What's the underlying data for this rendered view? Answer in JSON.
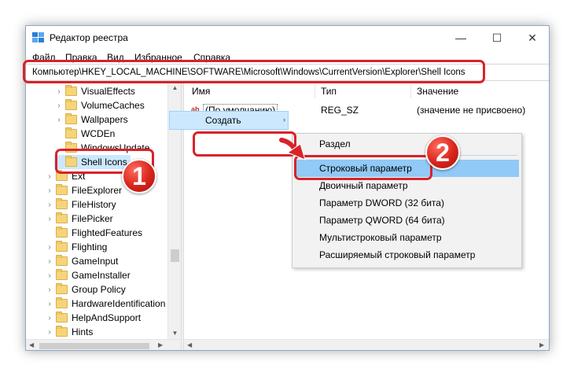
{
  "window": {
    "title": "Редактор реестра",
    "minimize_glyph": "—",
    "maximize_glyph": "☐",
    "close_glyph": "✕"
  },
  "menu": [
    "Файл",
    "Правка",
    "Вид",
    "Избранное",
    "Справка"
  ],
  "address": "Компьютер\\HKEY_LOCAL_MACHINE\\SOFTWARE\\Microsoft\\Windows\\CurrentVersion\\Explorer\\Shell Icons",
  "tree": {
    "items": [
      {
        "label": "VisualEffects",
        "expander": "›"
      },
      {
        "label": "VolumeCaches",
        "expander": "›"
      },
      {
        "label": "Wallpapers",
        "expander": "›"
      },
      {
        "label": "WCDEn",
        "expander": ""
      },
      {
        "label": "WindowsUpdate",
        "expander": ""
      },
      {
        "label": "Shell Icons",
        "expander": ""
      },
      {
        "label": "Ext",
        "expander": "›"
      },
      {
        "label": "FileExplorer",
        "expander": "›"
      },
      {
        "label": "FileHistory",
        "expander": "›"
      },
      {
        "label": "FilePicker",
        "expander": "›"
      },
      {
        "label": "FlightedFeatures",
        "expander": ""
      },
      {
        "label": "Flighting",
        "expander": "›"
      },
      {
        "label": "GameInput",
        "expander": "›"
      },
      {
        "label": "GameInstaller",
        "expander": "›"
      },
      {
        "label": "Group Policy",
        "expander": "›"
      },
      {
        "label": "HardwareIdentification",
        "expander": "›"
      },
      {
        "label": "HelpAndSupport",
        "expander": "›"
      },
      {
        "label": "Hints",
        "expander": "›"
      }
    ]
  },
  "columns": {
    "name": "Имя",
    "type": "Тип",
    "data": "Значение"
  },
  "values": [
    {
      "icon": "ab",
      "name": "(По умолчанию)",
      "type": "REG_SZ",
      "data": "(значение не присвоено)"
    }
  ],
  "context_menu": {
    "create_label": "Создать",
    "submenu_arrow": "›"
  },
  "submenu": {
    "items": [
      "Раздел",
      "Строковый параметр",
      "Двоичный параметр",
      "Параметр DWORD (32 бита)",
      "Параметр QWORD (64 бита)",
      "Мультистроковый параметр",
      "Расширяемый строковый параметр"
    ],
    "highlighted_index": 1
  },
  "callouts": {
    "step1": "1",
    "step2": "2",
    "color": "#d8232a"
  }
}
